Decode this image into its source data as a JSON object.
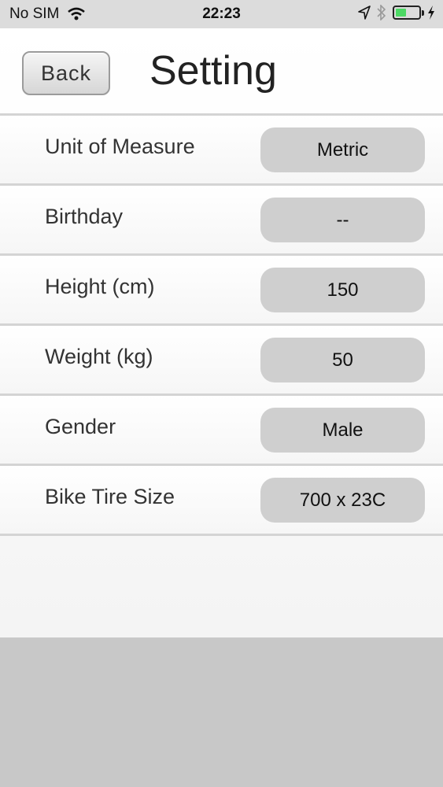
{
  "status_bar": {
    "carrier": "No SIM",
    "time": "22:23",
    "battery_level": 0.45,
    "icons": [
      "wifi-icon",
      "location-arrow-icon",
      "bluetooth-icon",
      "battery-icon",
      "charging-bolt-icon"
    ],
    "battery_color": "#4cd964"
  },
  "header": {
    "back_label": "Back",
    "title": "Setting"
  },
  "rows": [
    {
      "label": "Unit of Measure",
      "value": "Metric"
    },
    {
      "label": "Birthday",
      "value": "--"
    },
    {
      "label": "Height (cm)",
      "value": "150"
    },
    {
      "label": "Weight (kg)",
      "value": "50"
    },
    {
      "label": "Gender",
      "value": "Male"
    },
    {
      "label": "Bike Tire Size",
      "value": "700 x 23C"
    }
  ]
}
